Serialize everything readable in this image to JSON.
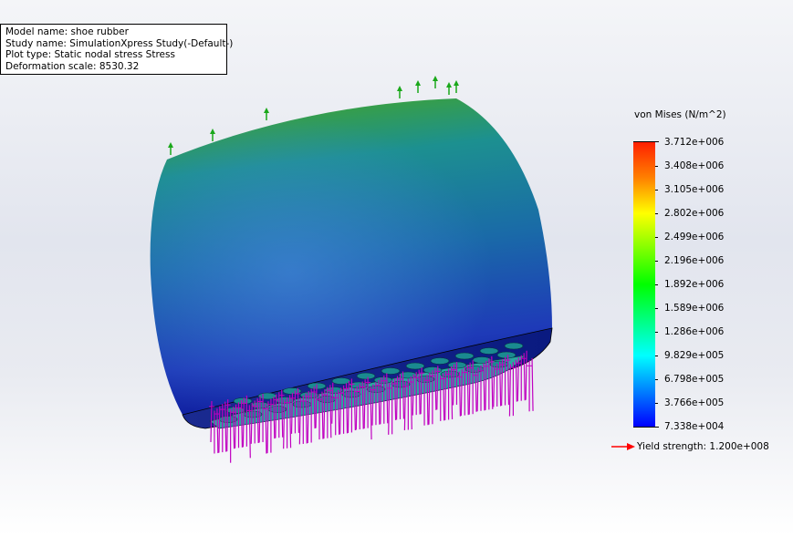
{
  "info_box": {
    "model_name": "Model name: shoe rubber",
    "study_name": "Study name: SimulationXpress Study(-Default-)",
    "plot_type": "Plot type: Static nodal stress Stress",
    "deformation_scale": "Deformation scale: 8530.32"
  },
  "legend": {
    "title": "von Mises (N/m^2)",
    "ticks": [
      "3.712e+006",
      "3.408e+006",
      "3.105e+006",
      "2.802e+006",
      "2.499e+006",
      "2.196e+006",
      "1.892e+006",
      "1.589e+006",
      "1.286e+006",
      "9.829e+005",
      "6.798e+005",
      "3.766e+005",
      "7.338e+004"
    ],
    "gradient": [
      "#ff2000",
      "#ff8000",
      "#ffff00",
      "#80ff00",
      "#00ff00",
      "#00ff80",
      "#00ffff",
      "#0080ff",
      "#0000ff"
    ],
    "yield_strength": "Yield strength: 1.200e+008",
    "yield_arrow_color": "#ff0000"
  },
  "colors": {
    "fixture": "#1aa81a",
    "load": "#c000c0"
  }
}
